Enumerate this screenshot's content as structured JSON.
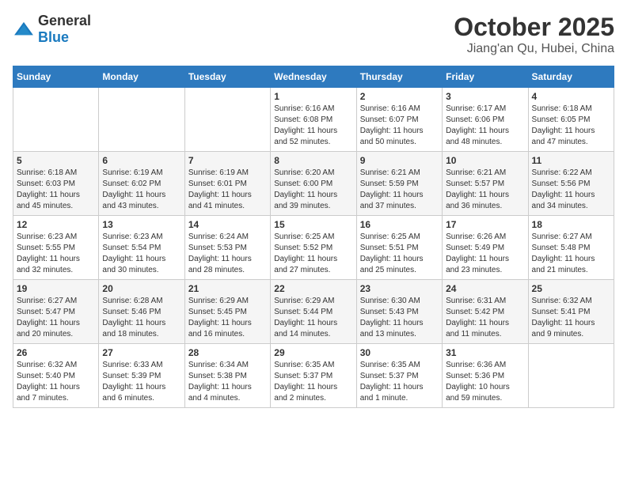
{
  "header": {
    "logo_general": "General",
    "logo_blue": "Blue",
    "month": "October 2025",
    "location": "Jiang'an Qu, Hubei, China"
  },
  "weekdays": [
    "Sunday",
    "Monday",
    "Tuesday",
    "Wednesday",
    "Thursday",
    "Friday",
    "Saturday"
  ],
  "weeks": [
    [
      {
        "day": "",
        "info": ""
      },
      {
        "day": "",
        "info": ""
      },
      {
        "day": "",
        "info": ""
      },
      {
        "day": "1",
        "info": "Sunrise: 6:16 AM\nSunset: 6:08 PM\nDaylight: 11 hours\nand 52 minutes."
      },
      {
        "day": "2",
        "info": "Sunrise: 6:16 AM\nSunset: 6:07 PM\nDaylight: 11 hours\nand 50 minutes."
      },
      {
        "day": "3",
        "info": "Sunrise: 6:17 AM\nSunset: 6:06 PM\nDaylight: 11 hours\nand 48 minutes."
      },
      {
        "day": "4",
        "info": "Sunrise: 6:18 AM\nSunset: 6:05 PM\nDaylight: 11 hours\nand 47 minutes."
      }
    ],
    [
      {
        "day": "5",
        "info": "Sunrise: 6:18 AM\nSunset: 6:03 PM\nDaylight: 11 hours\nand 45 minutes."
      },
      {
        "day": "6",
        "info": "Sunrise: 6:19 AM\nSunset: 6:02 PM\nDaylight: 11 hours\nand 43 minutes."
      },
      {
        "day": "7",
        "info": "Sunrise: 6:19 AM\nSunset: 6:01 PM\nDaylight: 11 hours\nand 41 minutes."
      },
      {
        "day": "8",
        "info": "Sunrise: 6:20 AM\nSunset: 6:00 PM\nDaylight: 11 hours\nand 39 minutes."
      },
      {
        "day": "9",
        "info": "Sunrise: 6:21 AM\nSunset: 5:59 PM\nDaylight: 11 hours\nand 37 minutes."
      },
      {
        "day": "10",
        "info": "Sunrise: 6:21 AM\nSunset: 5:57 PM\nDaylight: 11 hours\nand 36 minutes."
      },
      {
        "day": "11",
        "info": "Sunrise: 6:22 AM\nSunset: 5:56 PM\nDaylight: 11 hours\nand 34 minutes."
      }
    ],
    [
      {
        "day": "12",
        "info": "Sunrise: 6:23 AM\nSunset: 5:55 PM\nDaylight: 11 hours\nand 32 minutes."
      },
      {
        "day": "13",
        "info": "Sunrise: 6:23 AM\nSunset: 5:54 PM\nDaylight: 11 hours\nand 30 minutes."
      },
      {
        "day": "14",
        "info": "Sunrise: 6:24 AM\nSunset: 5:53 PM\nDaylight: 11 hours\nand 28 minutes."
      },
      {
        "day": "15",
        "info": "Sunrise: 6:25 AM\nSunset: 5:52 PM\nDaylight: 11 hours\nand 27 minutes."
      },
      {
        "day": "16",
        "info": "Sunrise: 6:25 AM\nSunset: 5:51 PM\nDaylight: 11 hours\nand 25 minutes."
      },
      {
        "day": "17",
        "info": "Sunrise: 6:26 AM\nSunset: 5:49 PM\nDaylight: 11 hours\nand 23 minutes."
      },
      {
        "day": "18",
        "info": "Sunrise: 6:27 AM\nSunset: 5:48 PM\nDaylight: 11 hours\nand 21 minutes."
      }
    ],
    [
      {
        "day": "19",
        "info": "Sunrise: 6:27 AM\nSunset: 5:47 PM\nDaylight: 11 hours\nand 20 minutes."
      },
      {
        "day": "20",
        "info": "Sunrise: 6:28 AM\nSunset: 5:46 PM\nDaylight: 11 hours\nand 18 minutes."
      },
      {
        "day": "21",
        "info": "Sunrise: 6:29 AM\nSunset: 5:45 PM\nDaylight: 11 hours\nand 16 minutes."
      },
      {
        "day": "22",
        "info": "Sunrise: 6:29 AM\nSunset: 5:44 PM\nDaylight: 11 hours\nand 14 minutes."
      },
      {
        "day": "23",
        "info": "Sunrise: 6:30 AM\nSunset: 5:43 PM\nDaylight: 11 hours\nand 13 minutes."
      },
      {
        "day": "24",
        "info": "Sunrise: 6:31 AM\nSunset: 5:42 PM\nDaylight: 11 hours\nand 11 minutes."
      },
      {
        "day": "25",
        "info": "Sunrise: 6:32 AM\nSunset: 5:41 PM\nDaylight: 11 hours\nand 9 minutes."
      }
    ],
    [
      {
        "day": "26",
        "info": "Sunrise: 6:32 AM\nSunset: 5:40 PM\nDaylight: 11 hours\nand 7 minutes."
      },
      {
        "day": "27",
        "info": "Sunrise: 6:33 AM\nSunset: 5:39 PM\nDaylight: 11 hours\nand 6 minutes."
      },
      {
        "day": "28",
        "info": "Sunrise: 6:34 AM\nSunset: 5:38 PM\nDaylight: 11 hours\nand 4 minutes."
      },
      {
        "day": "29",
        "info": "Sunrise: 6:35 AM\nSunset: 5:37 PM\nDaylight: 11 hours\nand 2 minutes."
      },
      {
        "day": "30",
        "info": "Sunrise: 6:35 AM\nSunset: 5:37 PM\nDaylight: 11 hours\nand 1 minute."
      },
      {
        "day": "31",
        "info": "Sunrise: 6:36 AM\nSunset: 5:36 PM\nDaylight: 10 hours\nand 59 minutes."
      },
      {
        "day": "",
        "info": ""
      }
    ]
  ]
}
